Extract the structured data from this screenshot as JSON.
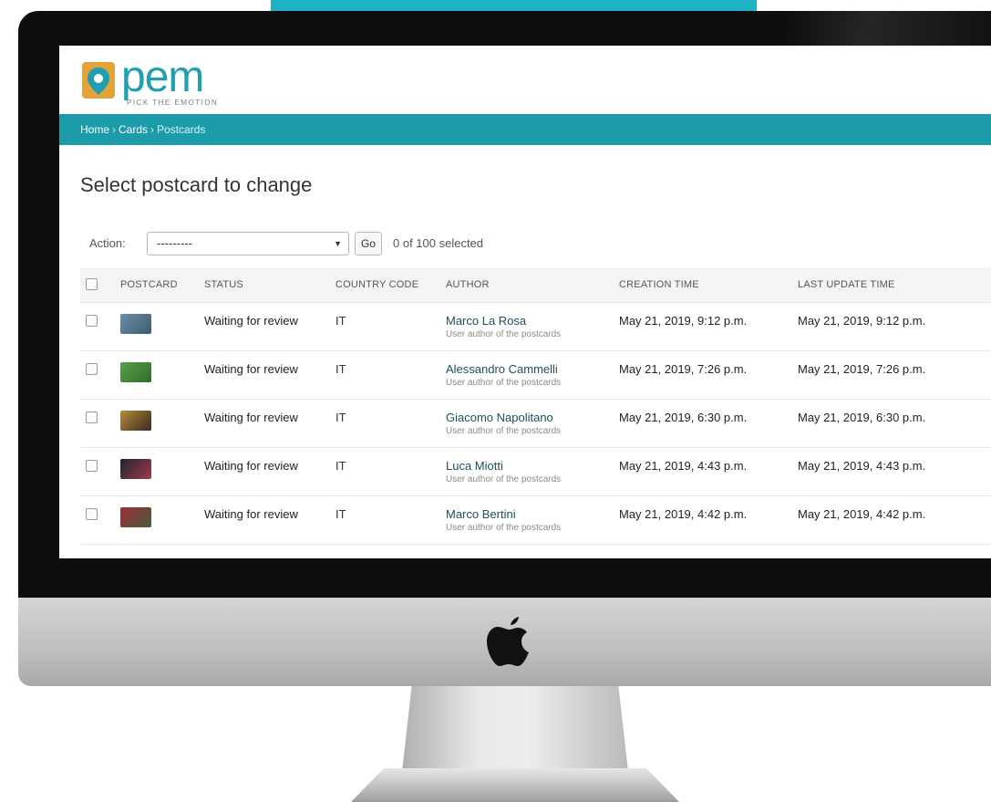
{
  "branding": {
    "logo_text": "pem",
    "tagline": "PICK THE EMOTION",
    "accent_color": "#1fb2c4",
    "header_band_color": "#1c9ba9"
  },
  "breadcrumbs": [
    {
      "label": "Home"
    },
    {
      "label": "Cards"
    },
    {
      "label": "Postcards"
    }
  ],
  "breadcrumb_separator": "›",
  "page_title": "Select postcard to change",
  "actions": {
    "label": "Action:",
    "selected_option": "---------",
    "go_label": "Go",
    "selection_count": "0 of 100 selected"
  },
  "table": {
    "columns": [
      "POSTCARD",
      "STATUS",
      "COUNTRY CODE",
      "AUTHOR",
      "CREATION TIME",
      "LAST UPDATE TIME"
    ],
    "rows": [
      {
        "thumb_colors": [
          "#6a8fa8",
          "#3d5b6e"
        ],
        "status": "Waiting for review",
        "country_code": "IT",
        "author_name": "Marco La Rosa",
        "author_desc": "User author of the postcards",
        "creation_time": "May 21, 2019, 9:12 p.m.",
        "last_update_time": "May 21, 2019, 9:12 p.m."
      },
      {
        "thumb_colors": [
          "#5aa04a",
          "#2f6b2a"
        ],
        "status": "Waiting for review",
        "country_code": "IT",
        "author_name": "Alessandro Cammelli",
        "author_desc": "User author of the postcards",
        "creation_time": "May 21, 2019, 7:26 p.m.",
        "last_update_time": "May 21, 2019, 7:26 p.m."
      },
      {
        "thumb_colors": [
          "#b58b3c",
          "#3a2b1e"
        ],
        "status": "Waiting for review",
        "country_code": "IT",
        "author_name": "Giacomo Napolitano",
        "author_desc": "User author of the postcards",
        "creation_time": "May 21, 2019, 6:30 p.m.",
        "last_update_time": "May 21, 2019, 6:30 p.m."
      },
      {
        "thumb_colors": [
          "#1d2433",
          "#a33a4a"
        ],
        "status": "Waiting for review",
        "country_code": "IT",
        "author_name": "Luca Miotti",
        "author_desc": "User author of the postcards",
        "creation_time": "May 21, 2019, 4:43 p.m.",
        "last_update_time": "May 21, 2019, 4:43 p.m."
      },
      {
        "thumb_colors": [
          "#9a2f3a",
          "#4a5a3a"
        ],
        "status": "Waiting for review",
        "country_code": "IT",
        "author_name": "Marco Bertini",
        "author_desc": "User author of the postcards",
        "creation_time": "May 21, 2019, 4:42 p.m.",
        "last_update_time": "May 21, 2019, 4:42 p.m."
      }
    ]
  }
}
